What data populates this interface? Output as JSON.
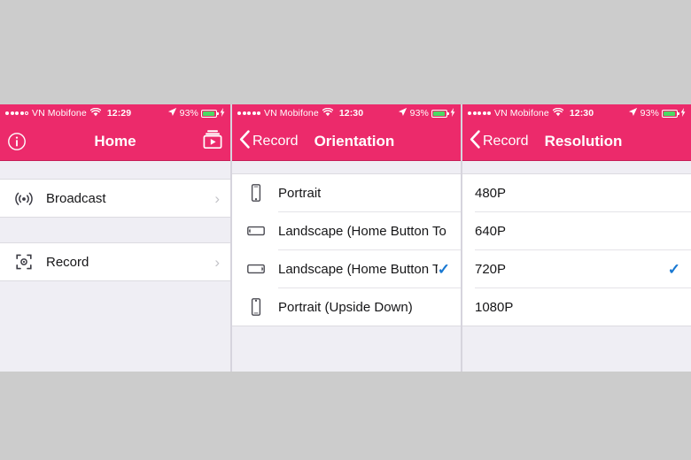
{
  "theme": {
    "accent_pink": "#EC2A6B",
    "list_bg": "#EFEEF4",
    "check_blue": "#1878D2",
    "battery_green": "#4CD964",
    "page_bg": "#CCCCCC"
  },
  "panels": [
    {
      "id": "home",
      "status": {
        "carrier": "VN Mobifone",
        "signal_filled": 4,
        "signal_total": 5,
        "wifi_icon": "wifi-icon",
        "time": "12:29",
        "location_icon": "location-arrow-icon",
        "battery_percent": "93%",
        "battery_fill": 93,
        "charging_icon": "lightning-bolt-icon"
      },
      "nav": {
        "left_icon": "info-circle-icon",
        "title": "Home",
        "right_icon": "media-library-icon"
      },
      "sections": [
        {
          "rows": [
            {
              "icon": "broadcast-icon",
              "label": "Broadcast",
              "accessory": "chevron"
            }
          ]
        },
        {
          "rows": [
            {
              "icon": "record-focus-icon",
              "label": "Record",
              "accessory": "chevron"
            }
          ]
        }
      ]
    },
    {
      "id": "orientation",
      "status": {
        "carrier": "VN Mobifone",
        "signal_filled": 5,
        "signal_total": 5,
        "wifi_icon": "wifi-icon",
        "time": "12:30",
        "location_icon": "location-arrow-icon",
        "battery_percent": "93%",
        "battery_fill": 93,
        "charging_icon": "lightning-bolt-icon"
      },
      "nav": {
        "back_icon": "chevron-left-icon",
        "back_label": "Record",
        "title": "Orientation"
      },
      "sections": [
        {
          "rows": [
            {
              "icon": "phone-portrait-icon",
              "label": "Portrait",
              "accessory": "none"
            },
            {
              "icon": "phone-landscape-left-icon",
              "label": "Landscape (Home Button To L…",
              "accessory": "none"
            },
            {
              "icon": "phone-landscape-right-icon",
              "label": "Landscape (Home Button T…",
              "accessory": "check"
            },
            {
              "icon": "phone-upside-down-icon",
              "label": "Portrait (Upside Down)",
              "accessory": "none"
            }
          ]
        }
      ]
    },
    {
      "id": "resolution",
      "status": {
        "carrier": "VN Mobifone",
        "signal_filled": 5,
        "signal_total": 5,
        "wifi_icon": "wifi-icon",
        "time": "12:30",
        "location_icon": "location-arrow-icon",
        "battery_percent": "93%",
        "battery_fill": 93,
        "charging_icon": "lightning-bolt-icon"
      },
      "nav": {
        "back_icon": "chevron-left-icon",
        "back_label": "Record",
        "title": "Resolution"
      },
      "sections": [
        {
          "rows": [
            {
              "label": "480P",
              "accessory": "none"
            },
            {
              "label": "640P",
              "accessory": "none"
            },
            {
              "label": "720P",
              "accessory": "check"
            },
            {
              "label": "1080P",
              "accessory": "none"
            }
          ]
        }
      ]
    }
  ],
  "glyphs": {
    "chevron_right": "›",
    "chevron_left": "‹",
    "check": "✓"
  }
}
